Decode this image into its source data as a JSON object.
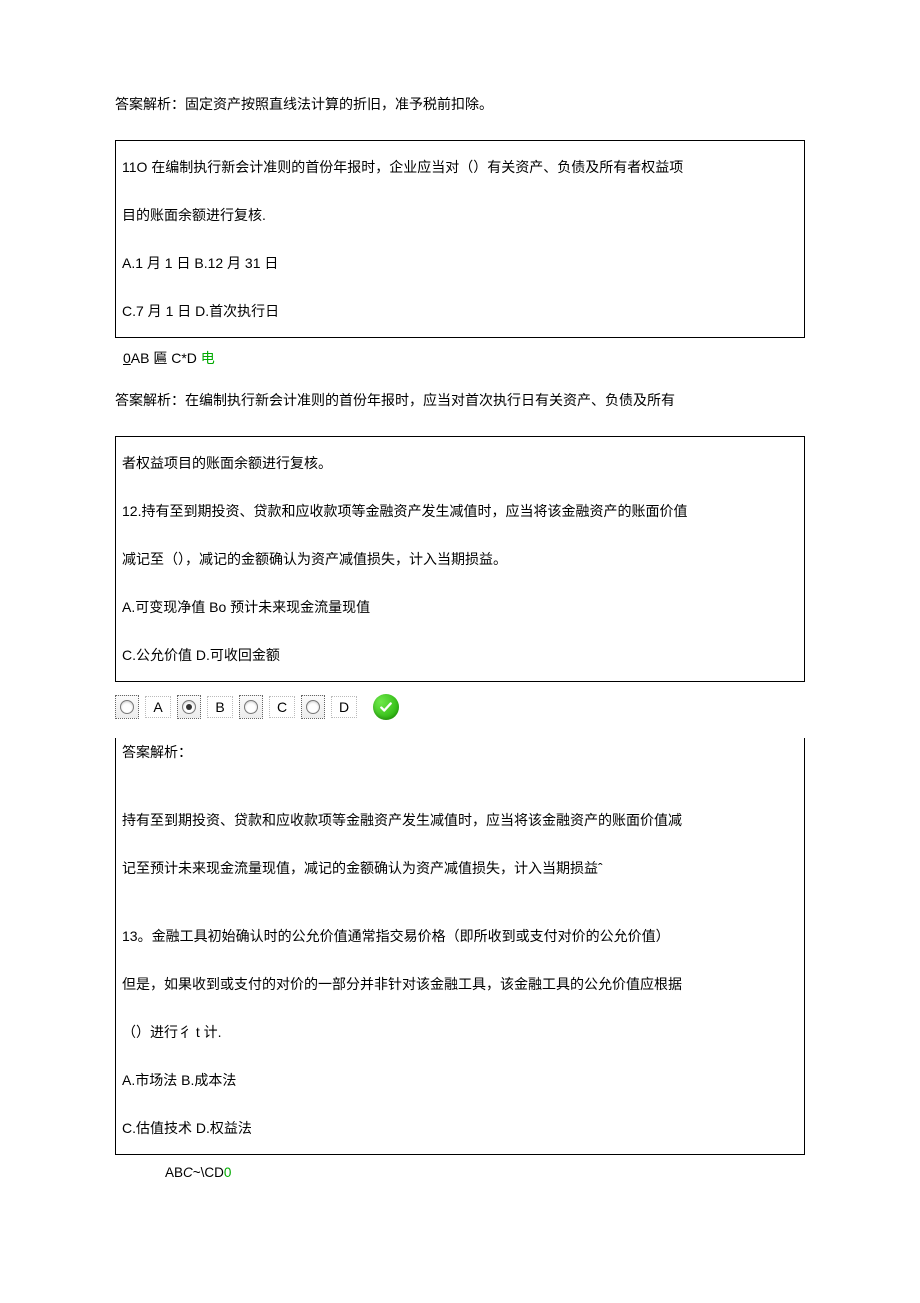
{
  "top_answer": "答案解析：固定资产按照直线法计算的折旧，准予税前扣除。",
  "q11": {
    "box1_l1": "11O 在编制执行新会计准则的首份年报时，企业应当对（）有关资产、负债及所有者权益项",
    "box1_l2": "目的账面余额进行复核.",
    "box1_l3": "A.1 月 1 日 B.12 月 31 日",
    "box1_l4": "C.7 月 1 日 D.首次执行日",
    "choice_prefix": "0",
    "choice_mid": "AB 匾 C*D",
    "choice_suffix": " 电",
    "answer": "答案解析：在编制执行新会计准则的首份年报时，应当对首次执行日有关资产、负债及所有"
  },
  "q12": {
    "box2_l1": "者权益项目的账面余额进行复核。",
    "box2_l2": "12.持有至到期投资、贷款和应收款项等金融资产发生减值时，应当将该金融资产的账面价值",
    "box2_l3": "减记至（），减记的金额确认为资产减值损失，计入当期损益。",
    "box2_l4": "A.可变现净值 Bo 预计未来现金流量现值",
    "box2_l5": "C.公允价值 D.可收回金额",
    "opts": {
      "a": "A",
      "b": "B",
      "c": "C",
      "d": "D"
    },
    "selected": "B",
    "box3_l1": "答案解析：",
    "box3_l2": "持有至到期投资、贷款和应收款项等金融资产发生减值时，应当将该金融资产的账面价值减",
    "box3_l3": "记至预计未来现金流量现值，减记的金额确认为资产减值损失，计入当期损益ˆ"
  },
  "q13": {
    "l1": "13。金融工具初始确认时的公允价值通常指交易价格（即所收到或支付对价的公允价值）",
    "l2": "但是，如果收到或支付的对价的一部分并非针对该金融工具，该金融工具的公允价值应根据",
    "l3": "（）进行彳 t 计.",
    "l4": "A.市场法 B.成本法",
    "l5": "C.估值技术 D.权益法",
    "choice_a": "AB",
    "choice_b": "C",
    "choice_c": "~\\CD",
    "choice_d": "0"
  }
}
